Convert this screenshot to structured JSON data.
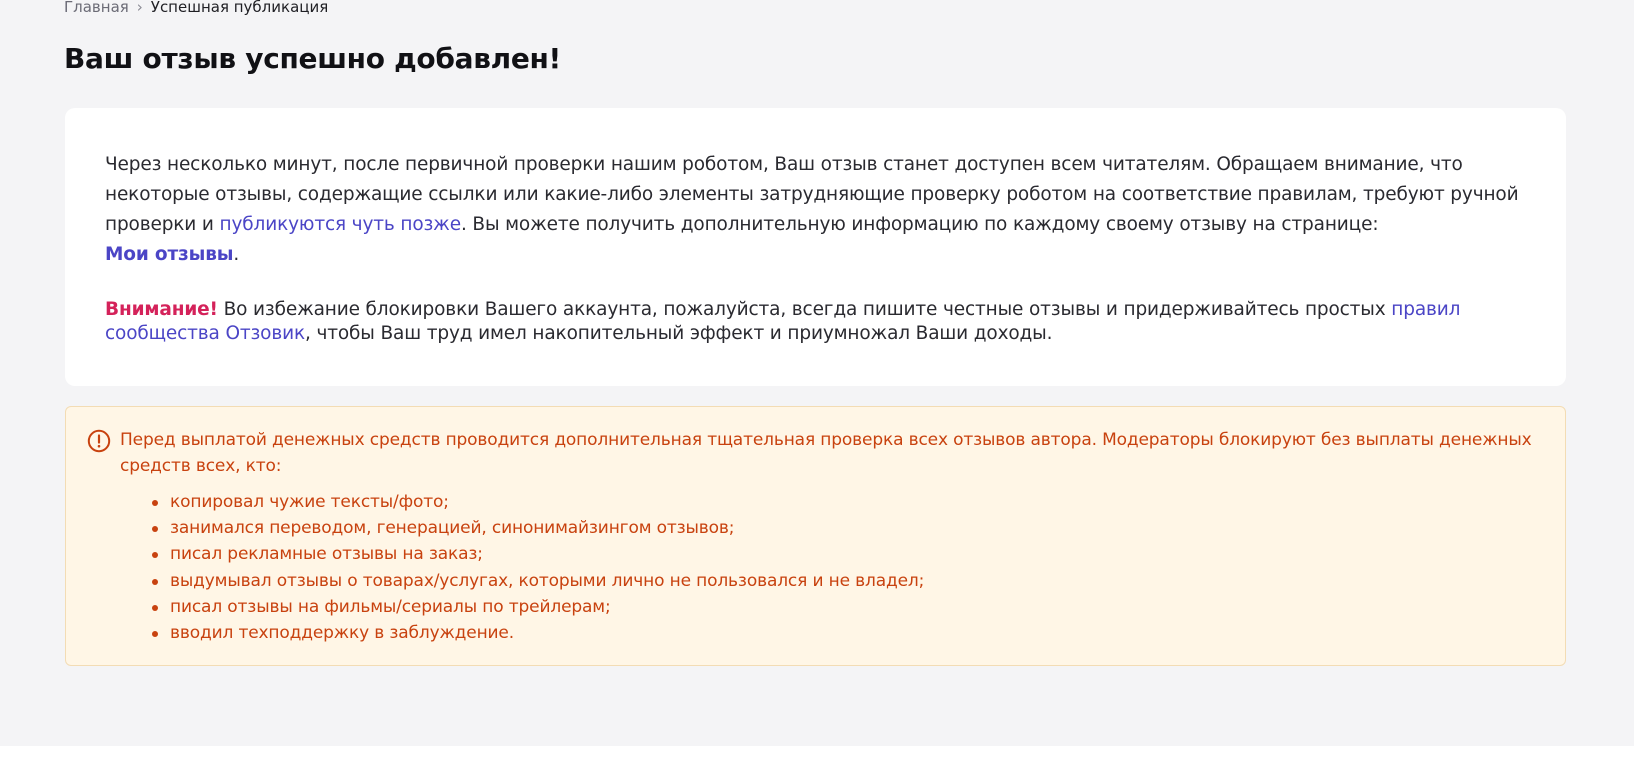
{
  "breadcrumb": {
    "home": "Главная",
    "separator": "›",
    "current": "Успешная публикация"
  },
  "page": {
    "title": "Ваш отзыв успешно добавлен!"
  },
  "card": {
    "text_part1": "Через несколько минут, после первичной проверки нашим роботом, Ваш отзыв станет доступен всем читателям. Обращаем внимание, что некоторые отзывы, содержащие ссылки или какие-либо элементы затрудняющие проверку роботом на соответствие правилам, требуют ручной проверки и ",
    "link_later": "публикуются чуть позже",
    "text_part2": ". Вы можете получить дополнительную информацию по каждому своему отзыву на странице: ",
    "link_my_reviews": "Мои отзывы",
    "text_part3": "."
  },
  "warning": {
    "attention": "Внимание!",
    "text_part1": " Во избежание блокировки Вашего аккаунта, пожалуйста, всегда пишите честные отзывы и придерживайтесь простых ",
    "link_rules": "правил сообщества Отзовик",
    "text_part2": ", чтобы Ваш труд имел накопительный эффект и приумножал Ваши доходы."
  },
  "notice": {
    "icon": "exclamation-circle-icon",
    "color": "#c8420f",
    "background": "#fff6e6",
    "intro": "Перед выплатой денежных средств проводится дополнительная тщательная проверка всех отзывов автора. Модераторы блокируют без выплаты денежных средств всех, кто:",
    "items": [
      "копировал чужие тексты/фото;",
      "занимался переводом, генерацией, синонимайзингом отзывов;",
      "писал рекламные отзывы на заказ;",
      "выдумывал отзывы о товарах/услугах, которыми лично не пользовался и не владел;",
      "писал отзывы на фильмы/сериалы по трейлерам;",
      "вводил техподдержку в заблуждение."
    ]
  },
  "colors": {
    "link": "#4b45c6",
    "attention": "#d4225a",
    "page_background": "#f4f4f6"
  }
}
